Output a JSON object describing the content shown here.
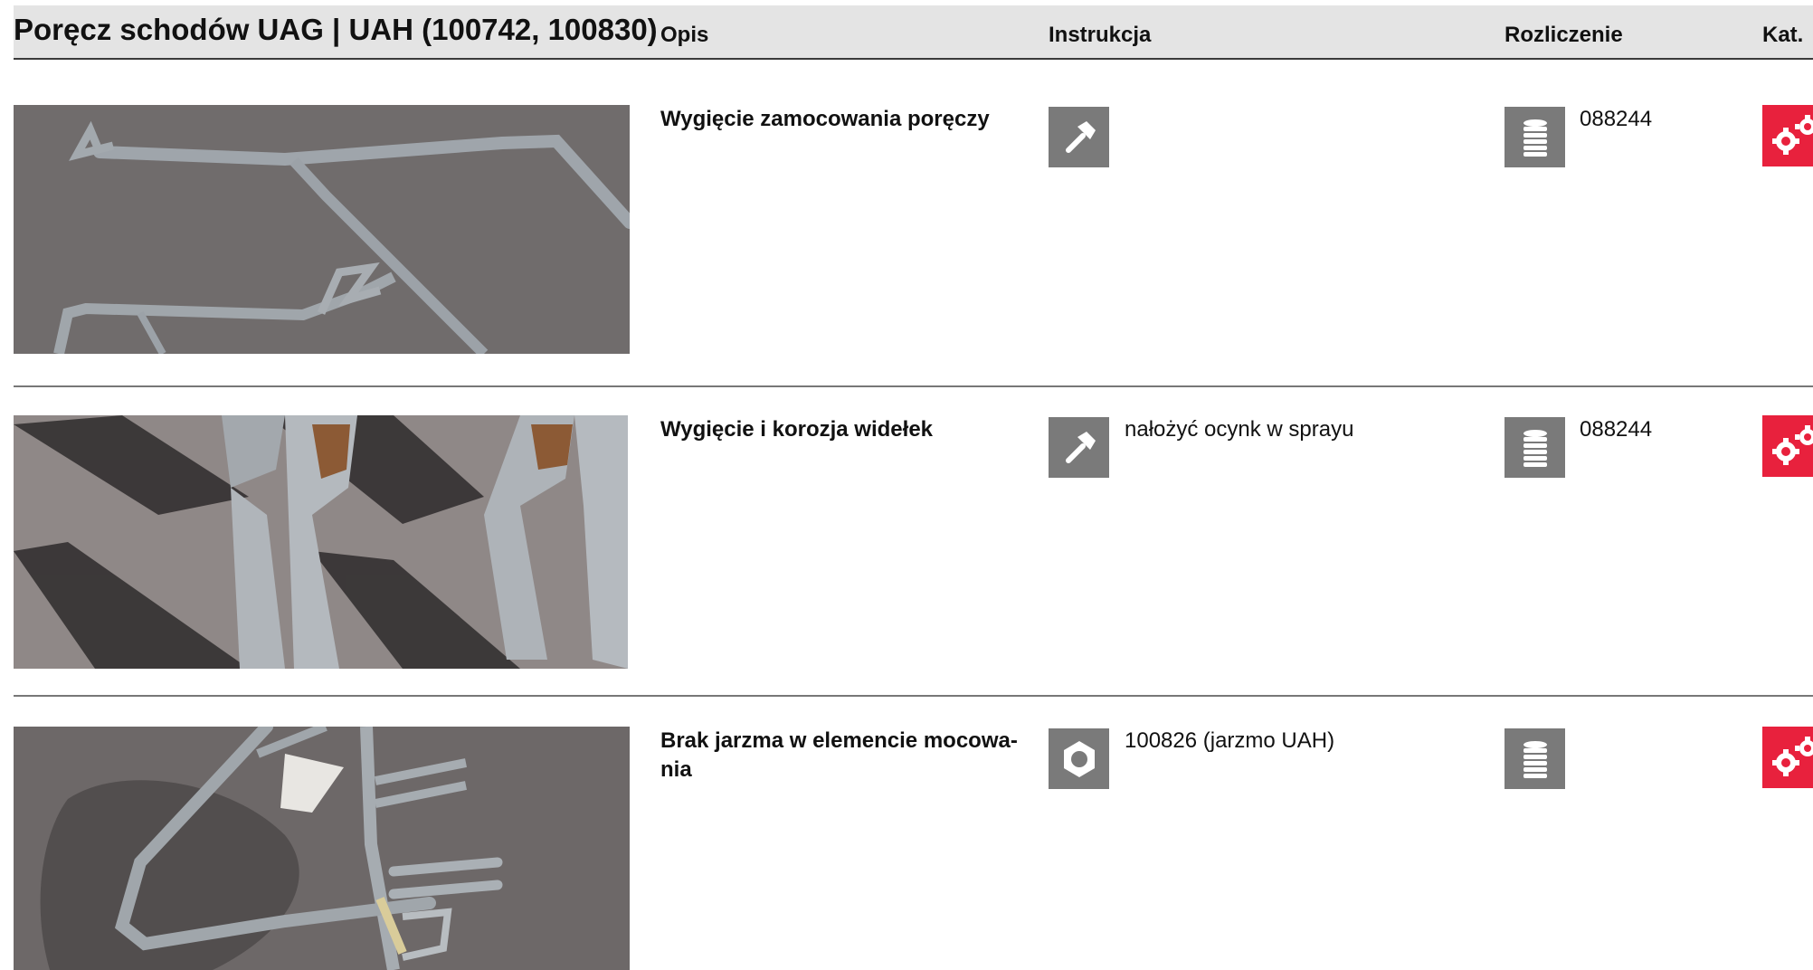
{
  "header": {
    "title": "Poręcz schodów UAG | UAH (100742, 100830)",
    "col_opis": "Opis",
    "col_instrukcja": "Instrukcja",
    "col_rozliczenie": "Rozliczenie",
    "col_kat": "Kat."
  },
  "rows": [
    {
      "description": "Wygięcie zamocowania poręczy",
      "instruction_icon": "hammer-icon",
      "instruction_text": "",
      "billing_icon": "coin-stack-icon",
      "billing_text": "088244",
      "category_icon": "gears-icon"
    },
    {
      "description": "Wygięcie i korozja widełek",
      "instruction_icon": "hammer-icon",
      "instruction_text": "nałożyć ocynk w sprayu",
      "billing_icon": "coin-stack-icon",
      "billing_text": "088244",
      "category_icon": "gears-icon"
    },
    {
      "description": "Brak jarzma w elemencie mocowa-\nnia",
      "instruction_icon": "hex-nut-icon",
      "instruction_text": "100826 (jarzmo UAH)",
      "billing_icon": "coin-stack-icon",
      "billing_text": "",
      "category_icon": "gears-icon"
    }
  ],
  "colors": {
    "header_bg": "#e4e4e4",
    "icon_bg": "#7a7a7a",
    "category_red": "#e8213d"
  }
}
